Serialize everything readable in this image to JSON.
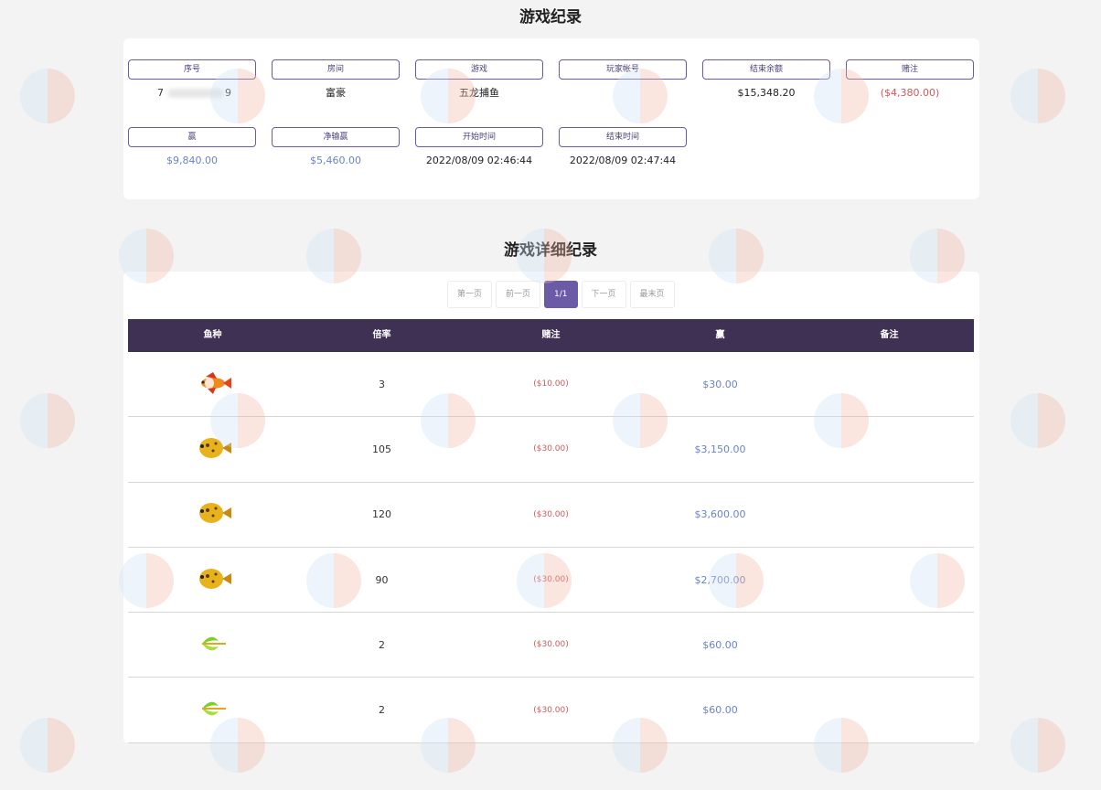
{
  "titles": {
    "record": "游戏纪录",
    "detail": "游戏详细纪录"
  },
  "summary": {
    "seq_label": "序号",
    "seq_value_start": "7",
    "seq_value_end": "9",
    "room_label": "房间",
    "room_value": "富豪",
    "game_label": "游戏",
    "game_value": "五龙捕鱼",
    "account_label": "玩家帐号",
    "account_value": "",
    "balance_label": "结束余额",
    "balance_value": "$15,348.20",
    "bet_label": "赌注",
    "bet_value": "($4,380.00)",
    "win_label": "赢",
    "win_value": "$9,840.00",
    "net_label": "净输赢",
    "net_value": "$5,460.00",
    "start_label": "开始时间",
    "start_value": "2022/08/09 02:46:44",
    "end_label": "结束时间",
    "end_value": "2022/08/09 02:47:44"
  },
  "pager": {
    "first": "第一页",
    "prev": "前一页",
    "current": "1/1",
    "next": "下一页",
    "last": "最末页"
  },
  "table": {
    "headers": [
      "鱼种",
      "倍率",
      "赌注",
      "赢",
      "备注"
    ],
    "rows": [
      {
        "fish": "orange-fish-icon",
        "rate": "3",
        "bet": "($10.00)",
        "win": "$30.00",
        "note": ""
      },
      {
        "fish": "golden-pufferfish-icon",
        "rate": "105",
        "bet": "($30.00)",
        "win": "$3,150.00",
        "note": ""
      },
      {
        "fish": "golden-pufferfish-icon",
        "rate": "120",
        "bet": "($30.00)",
        "win": "$3,600.00",
        "note": ""
      },
      {
        "fish": "golden-pufferfish-icon",
        "rate": "90",
        "bet": "($30.00)",
        "win": "$2,700.00",
        "note": ""
      },
      {
        "fish": "green-leaf-fish-icon",
        "rate": "2",
        "bet": "($30.00)",
        "win": "$60.00",
        "note": ""
      },
      {
        "fish": "green-leaf-fish-icon",
        "rate": "2",
        "bet": "($30.00)",
        "win": "$60.00",
        "note": ""
      }
    ]
  },
  "colors": {
    "accent": "#6b5ba6",
    "header_bg": "#3e3153",
    "negative": "#d3585b",
    "positive": "#6a82c9"
  }
}
